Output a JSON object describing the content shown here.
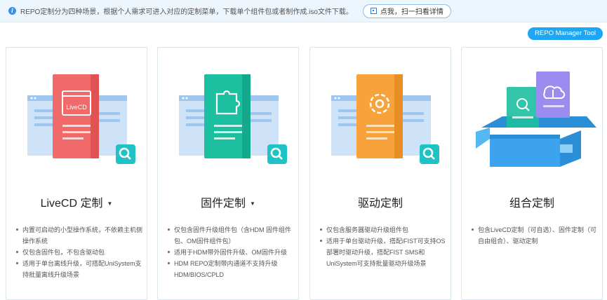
{
  "notice": {
    "text": "REPO定制分为四种场景，根据个人需求可进入对应的定制菜单，下载单个组件包或者制作成.iso文件下载。",
    "scan_label": "点我，扫一扫看详情"
  },
  "tool_button": "REPO Manager Tool",
  "cards": [
    {
      "title": "LiveCD 定制",
      "icon_label": "LiveCD",
      "accent": "#f06a6a",
      "bullets": [
        "内置可启动的小型操作系统，不依赖主机侧操作系统",
        "仅包含固件包，不包含驱动包",
        "适用于单台离线升级，可搭配UniSystem支持批量离线升级场景"
      ]
    },
    {
      "title": "固件定制",
      "accent": "#1cbfa0",
      "bullets": [
        "仅包含固件升级组件包（含HDM 固件组件包、OM固件组件包）",
        "适用于HDM带外固件升级、OM固件升级",
        "HDM REPO定制带内通道不支持升级HDM/BIOS/CPLD"
      ]
    },
    {
      "title": "驱动定制",
      "accent": "#f7a23a",
      "bullets": [
        "仅包含服务器驱动升级组件包",
        "适用于单台驱动升级，搭配iFIST可支持OS部署时驱动升级，搭配FIST SMS和UniSystem可支持批量驱动升级场景"
      ]
    },
    {
      "title": "组合定制",
      "accent": "#3d9be0",
      "bullets": [
        "包含LiveCD定制（可自选）、固件定制（可自由组合）、驱动定制"
      ]
    }
  ]
}
